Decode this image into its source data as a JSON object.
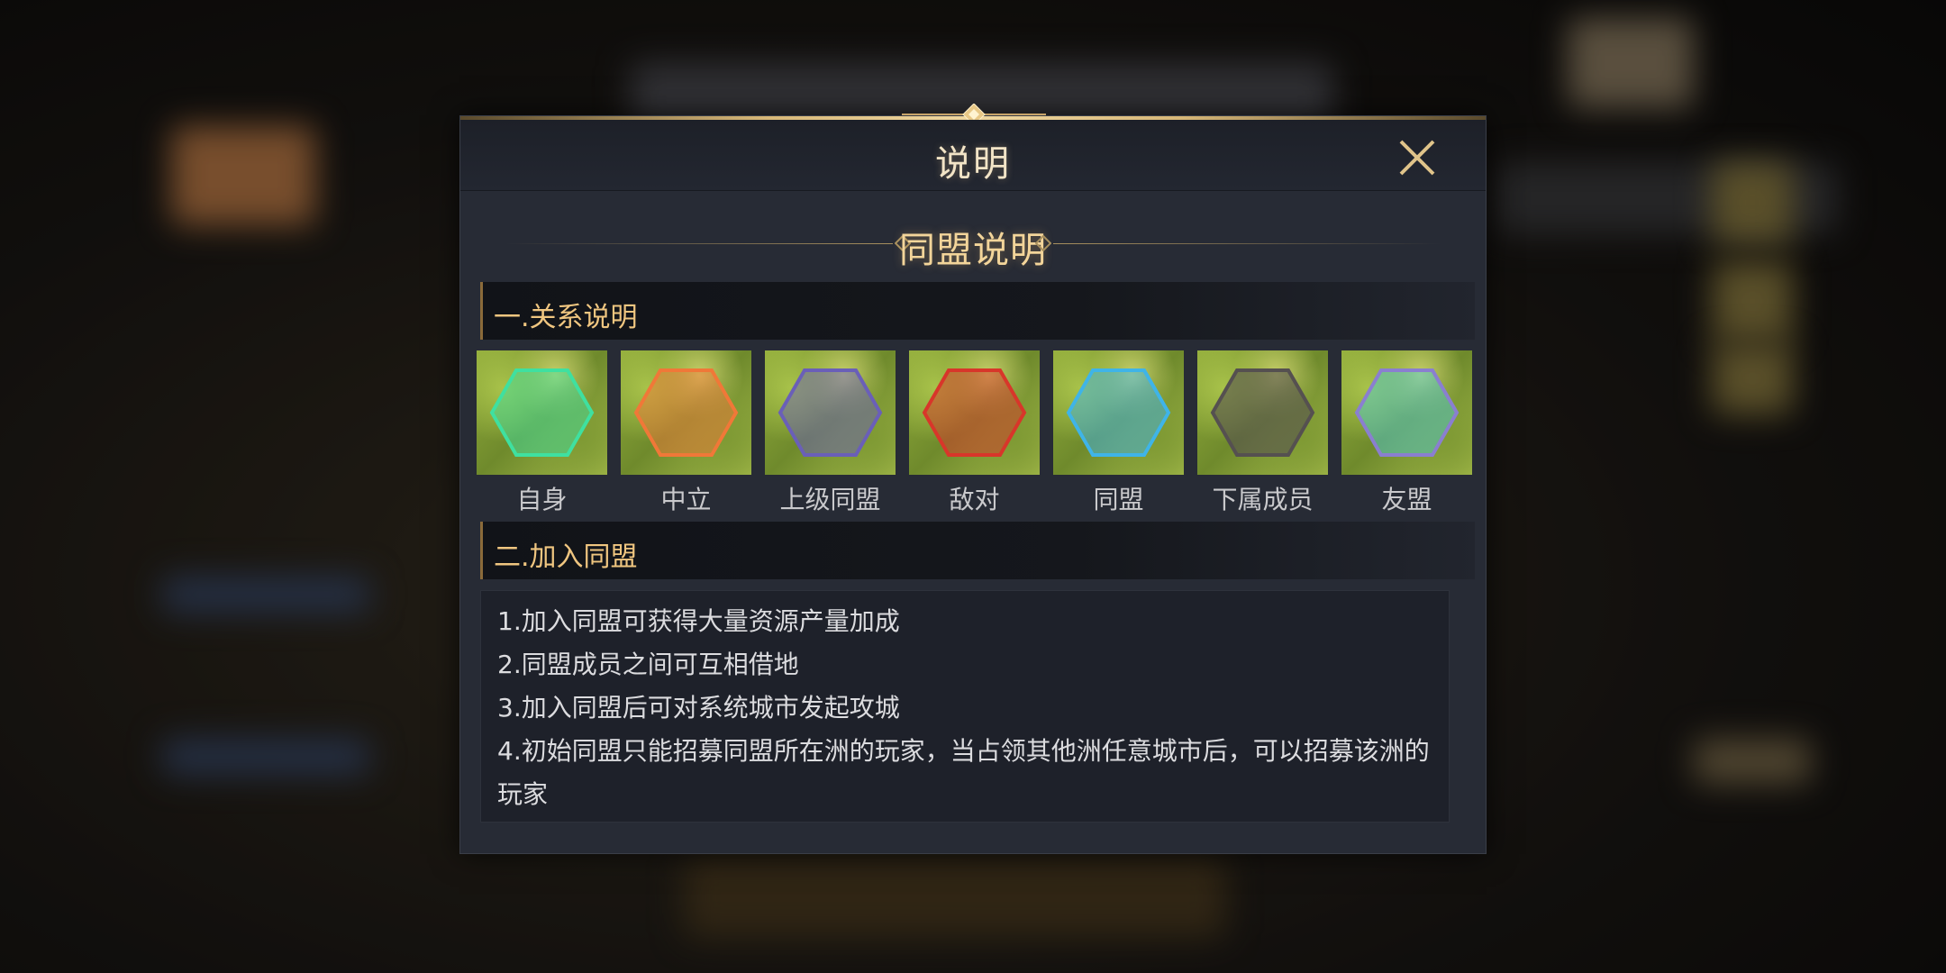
{
  "dialog": {
    "title": "说明",
    "subtitle": "同盟说明",
    "section1_label": "一.关系说明",
    "section2_label": "二.加入同盟",
    "relations": [
      {
        "name": "自身",
        "hex_color": "#3fe0a0"
      },
      {
        "name": "中立",
        "hex_color": "#f07838"
      },
      {
        "name": "上级同盟",
        "hex_color": "#6a5fb8"
      },
      {
        "name": "敌对",
        "hex_color": "#d8362a"
      },
      {
        "name": "同盟",
        "hex_color": "#3fb4e8"
      },
      {
        "name": "下属成员",
        "hex_color": "#555050"
      },
      {
        "name": "友盟",
        "hex_color": "#4fc8d0"
      }
    ],
    "rules": [
      "1.加入同盟可获得大量资源产量加成",
      "2.同盟成员之间可互相借地",
      "3.加入同盟后可对系统城市发起攻城",
      "4.初始同盟只能招募同盟所在洲的玩家，当占领其他洲任意城市后，可以招募该洲的玩家"
    ]
  },
  "icons": {
    "close": "close-icon"
  },
  "colors": {
    "accent_gold": "#f0c680",
    "title_text": "#f2e4c6",
    "panel_bg": "#272b35"
  }
}
